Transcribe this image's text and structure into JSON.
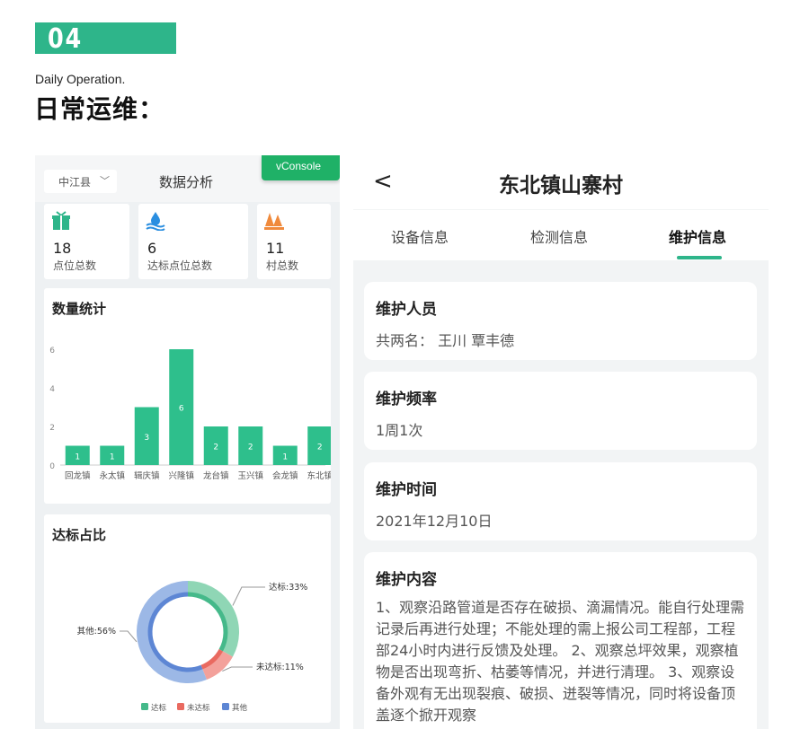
{
  "section": {
    "number": "04",
    "subtitle_en": "Daily Operation.",
    "title_cn": "日常运维："
  },
  "left_screen": {
    "county_select": "中江县",
    "title": "数据分析",
    "vconsole_label": "vConsole",
    "stats": [
      {
        "icon": "gift-box-icon",
        "color": "#2eb58a",
        "value": "18",
        "caption": "点位总数"
      },
      {
        "icon": "water-drop-icon",
        "color": "#2a8ee0",
        "value": "6",
        "caption": "达标点位总数"
      },
      {
        "icon": "village-tree-icon",
        "color": "#f08a3c",
        "value": "11",
        "caption": "村总数"
      }
    ],
    "bar_title": "数量统计",
    "pie_title": "达标占比"
  },
  "chart_data": [
    {
      "type": "bar",
      "title": "数量统计",
      "categories": [
        "回龙镇",
        "永太镇",
        "辑庆镇",
        "兴隆镇",
        "龙台镇",
        "玉兴镇",
        "会龙镇",
        "东北镇"
      ],
      "values": [
        1,
        1,
        3,
        6,
        2,
        2,
        1,
        2
      ],
      "ylim": [
        0,
        6
      ],
      "yticks": [
        "0",
        "2",
        "4",
        "6"
      ],
      "color": "#2ebf8c",
      "grid": false
    },
    {
      "type": "pie",
      "title": "达标占比",
      "labels": [
        "达标",
        "未达标",
        "其他"
      ],
      "display_labels": [
        "达标:33%",
        "未达标:11%",
        "其他:56%"
      ],
      "values": [
        33,
        11,
        56
      ],
      "colors": [
        "#8fd6b5",
        "#f3a19b",
        "#9cb8e6"
      ],
      "inner_colors": [
        "#45b98a",
        "#e96a60",
        "#5d86d4"
      ],
      "legend_position": "bottom"
    }
  ],
  "right_screen": {
    "title": "东北镇山寨村",
    "back": "<",
    "tabs": [
      "设备信息",
      "检测信息",
      "维护信息"
    ],
    "active_tab": "维护信息",
    "cards": [
      {
        "heading": "维护人员",
        "value": "共两名：  王川 覃丰德"
      },
      {
        "heading": "维护频率",
        "value": "1周1次"
      },
      {
        "heading": "维护时间",
        "value": "2021年12月10日"
      },
      {
        "heading": "维护内容",
        "value": "1、观察沿路管道是否存在破损、滴漏情况。能自行处理需记录后再进行处理；不能处理的需上报公司工程部，工程部24小时内进行反馈及处理。 2、观察总坪效果，观察植物是否出现弯折、枯萎等情况，并进行清理。 3、观察设备外观有无出现裂痕、破损、迸裂等情况，同时将设备顶盖逐个掀开观察"
      }
    ]
  }
}
